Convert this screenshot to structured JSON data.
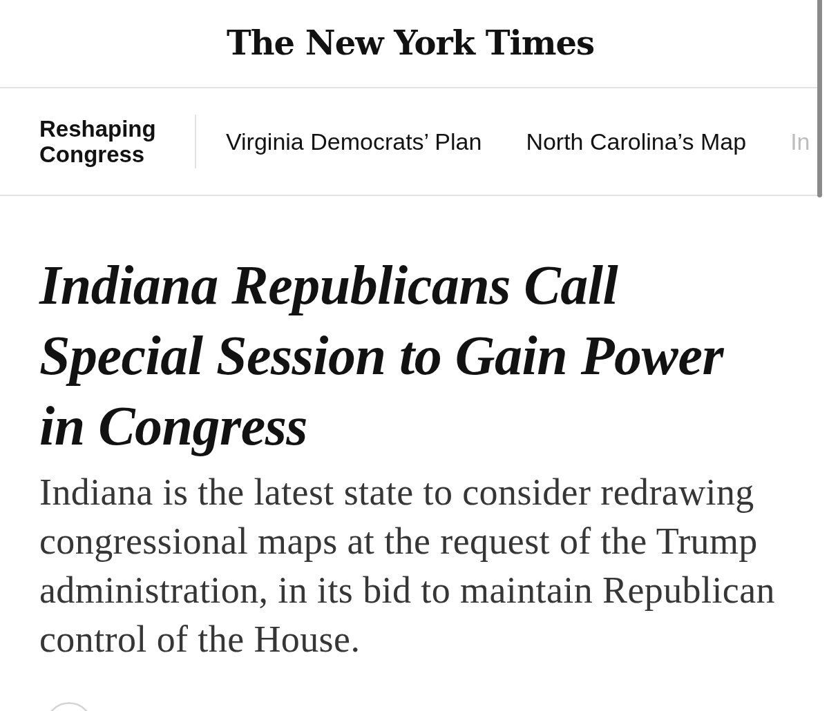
{
  "masthead": {
    "logo": "The New York Times"
  },
  "section_nav": {
    "title": "Reshaping Congress",
    "items": [
      {
        "label": "Virginia Democrats’ Plan",
        "dimmed": false
      },
      {
        "label": "North Carolina’s Map",
        "dimmed": false
      },
      {
        "label": "In",
        "dimmed": true
      }
    ]
  },
  "article": {
    "headline": "Indiana Republicans Call Special Session to Gain Power in Congress",
    "summary": "Indiana is the latest state to consider redrawing congressional maps at the request of the Trump administration, in its bid to maintain Republican control of the House."
  }
}
